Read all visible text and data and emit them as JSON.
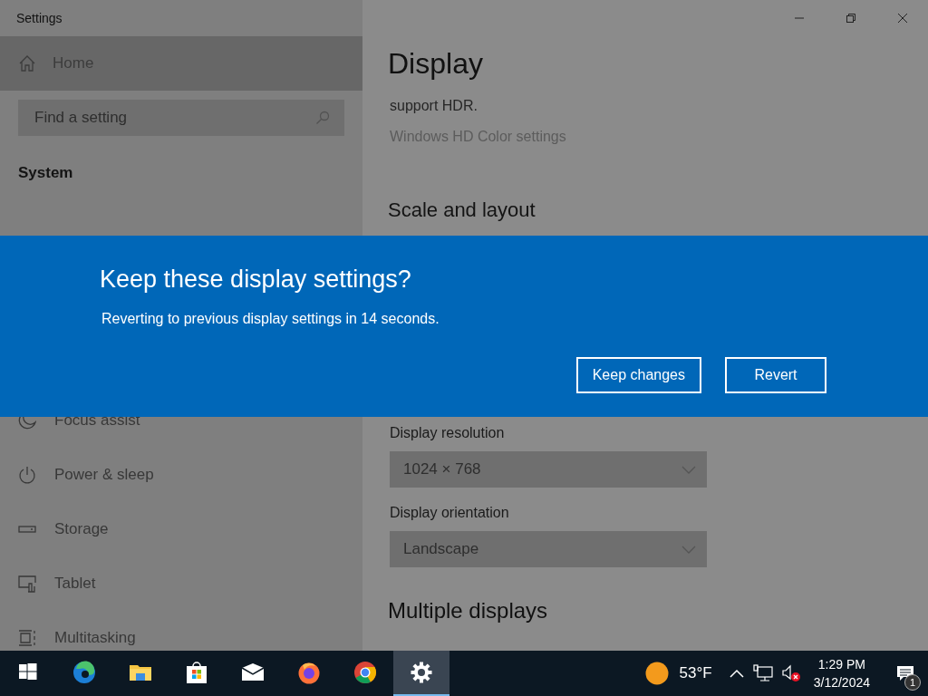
{
  "window": {
    "title": "Settings"
  },
  "sidebar": {
    "home": {
      "label": "Home",
      "selected": true
    },
    "search": {
      "placeholder": "Find a setting"
    },
    "section": "System",
    "items": [
      {
        "label": "Focus assist",
        "kind": "focus"
      },
      {
        "label": "Power & sleep",
        "kind": "power"
      },
      {
        "label": "Storage",
        "kind": "storage"
      },
      {
        "label": "Tablet",
        "kind": "tablet"
      },
      {
        "label": "Multitasking",
        "kind": "multitasking"
      }
    ]
  },
  "content": {
    "title": "Display",
    "hdr_text": "support HDR.",
    "link": "Windows HD Color settings",
    "section": "Scale and layout",
    "fields": [
      {
        "label": "Display resolution",
        "value": "1024 × 768"
      },
      {
        "label": "Display orientation",
        "value": "Landscape"
      }
    ],
    "section_2": "Multiple displays"
  },
  "dialog": {
    "title": "Keep these display settings?",
    "message": "Reverting to previous display settings in 14 seconds.",
    "buttons": [
      "Keep changes",
      "Revert"
    ]
  },
  "taskbar": {
    "apps": [
      {
        "kind": "start",
        "selected": false
      },
      {
        "kind": "edge",
        "selected": false
      },
      {
        "kind": "folder",
        "selected": false
      },
      {
        "kind": "store",
        "selected": false
      },
      {
        "kind": "mail",
        "selected": false
      },
      {
        "kind": "firefox",
        "selected": false
      },
      {
        "kind": "chrome",
        "selected": false
      },
      {
        "kind": "settings",
        "selected": true
      }
    ],
    "weather": "53°F",
    "volume_muted": true,
    "time": "1:29 PM",
    "date": "3/12/2024",
    "notifications": "1"
  }
}
